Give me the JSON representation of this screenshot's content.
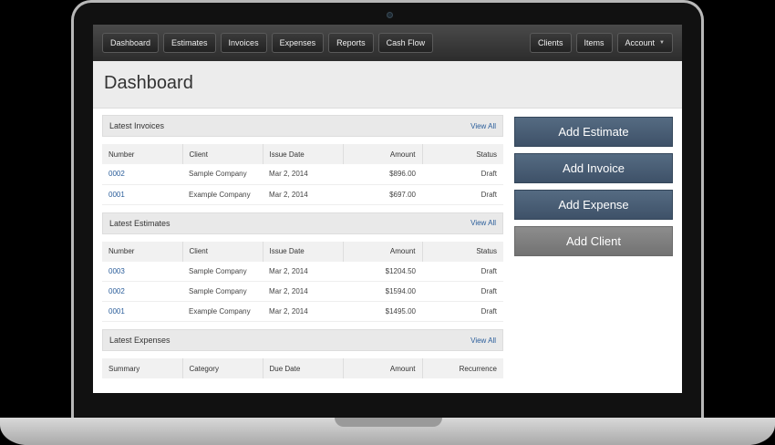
{
  "nav": {
    "left": [
      "Dashboard",
      "Estimates",
      "Invoices",
      "Expenses",
      "Reports",
      "Cash Flow"
    ],
    "right": [
      "Clients",
      "Items",
      "Account"
    ]
  },
  "page": {
    "title": "Dashboard"
  },
  "invoices": {
    "title": "Latest Invoices",
    "view_all": "View All",
    "columns": [
      "Number",
      "Client",
      "Issue Date",
      "Amount",
      "Status"
    ],
    "rows": [
      [
        "0002",
        "Sample Company",
        "Mar 2, 2014",
        "$896.00",
        "Draft"
      ],
      [
        "0001",
        "Example Company",
        "Mar 2, 2014",
        "$697.00",
        "Draft"
      ]
    ]
  },
  "estimates": {
    "title": "Latest Estimates",
    "view_all": "View All",
    "columns": [
      "Number",
      "Client",
      "Issue Date",
      "Amount",
      "Status"
    ],
    "rows": [
      [
        "0003",
        "Sample Company",
        "Mar 2, 2014",
        "$1204.50",
        "Draft"
      ],
      [
        "0002",
        "Sample Company",
        "Mar 2, 2014",
        "$1594.00",
        "Draft"
      ],
      [
        "0001",
        "Example Company",
        "Mar 2, 2014",
        "$1495.00",
        "Draft"
      ]
    ]
  },
  "expenses": {
    "title": "Latest Expenses",
    "view_all": "View All",
    "columns": [
      "Summary",
      "Category",
      "Due Date",
      "Amount",
      "Recurrence"
    ]
  },
  "actions": {
    "add_estimate": "Add Estimate",
    "add_invoice": "Add Invoice",
    "add_expense": "Add Expense",
    "add_client": "Add Client"
  },
  "colors": {
    "action_blue": "#4a5e76",
    "action_grey": "#808080",
    "link": "#2a5d9a"
  }
}
